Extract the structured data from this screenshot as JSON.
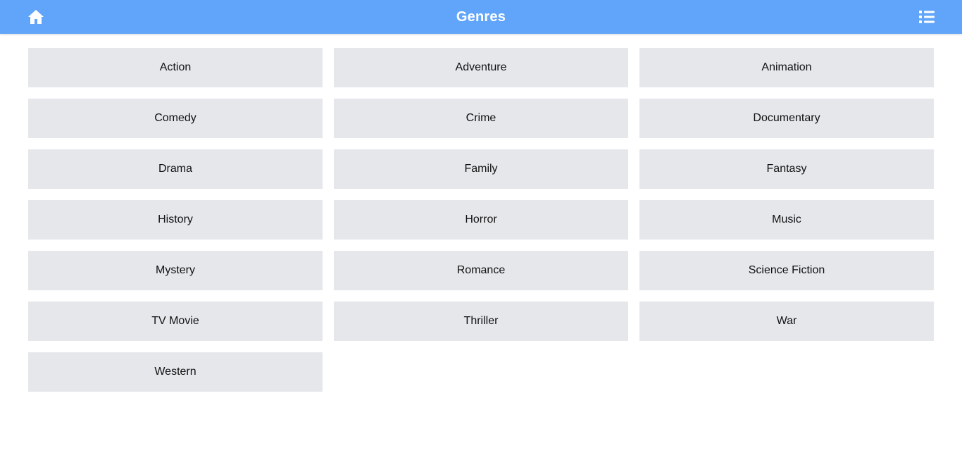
{
  "header": {
    "title": "Genres",
    "home_icon": "home-icon",
    "list_icon": "list-icon",
    "background_color": "#60a5fa"
  },
  "genres": [
    "Action",
    "Adventure",
    "Animation",
    "Comedy",
    "Crime",
    "Documentary",
    "Drama",
    "Family",
    "Fantasy",
    "History",
    "Horror",
    "Music",
    "Mystery",
    "Romance",
    "Science Fiction",
    "TV Movie",
    "Thriller",
    "War",
    "Western"
  ]
}
